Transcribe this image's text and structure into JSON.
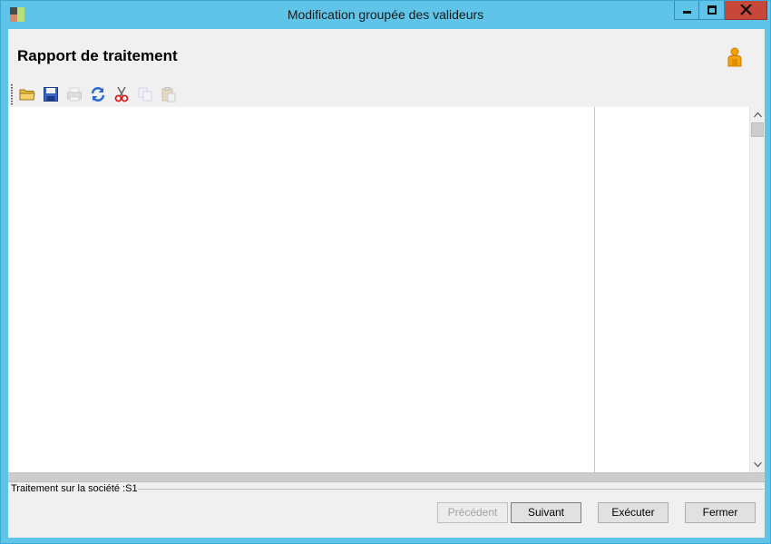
{
  "window": {
    "title": "Modification groupée des valideurs"
  },
  "header": {
    "title": "Rapport de traitement",
    "user_icon": "person-icon"
  },
  "toolbar": {
    "items": [
      {
        "icon": "open-folder-icon",
        "enabled": true
      },
      {
        "icon": "save-icon",
        "enabled": true
      },
      {
        "icon": "print-icon",
        "enabled": false
      },
      {
        "icon": "refresh-icon",
        "enabled": true
      },
      {
        "icon": "cut-icon",
        "enabled": true
      },
      {
        "icon": "copy-icon",
        "enabled": false
      },
      {
        "icon": "paste-icon",
        "enabled": false
      }
    ]
  },
  "status": {
    "text": "Traitement sur la société :S1"
  },
  "buttons": {
    "previous": "Précédent",
    "next": "Suivant",
    "execute": "Exécuter",
    "close": "Fermer"
  },
  "colors": {
    "titlebar": "#5fc4e8",
    "close_button": "#c7473a",
    "client_background": "#f0f0f0"
  }
}
